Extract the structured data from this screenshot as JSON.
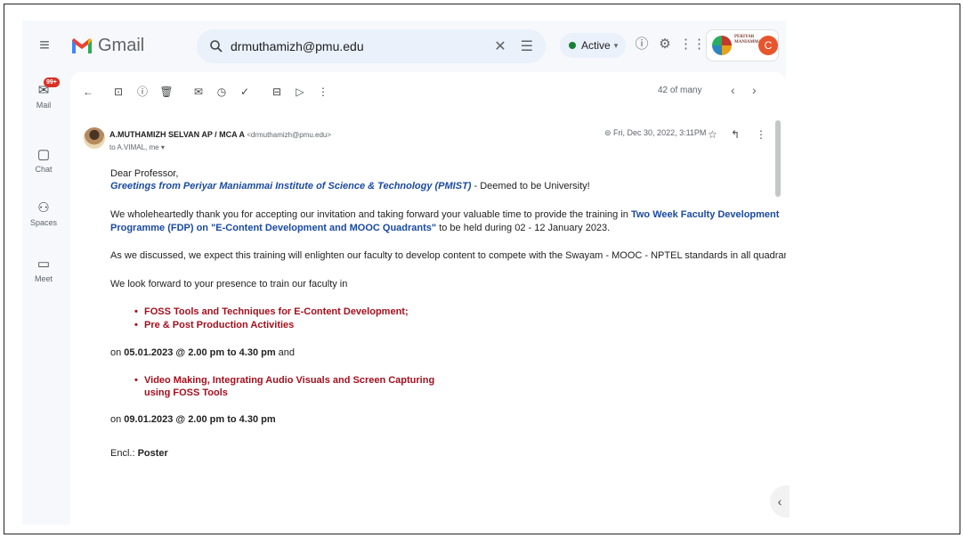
{
  "app": {
    "name": "Gmail",
    "brand_colors": [
      "#ea4335",
      "#4285f4",
      "#34a853",
      "#fbbc04"
    ]
  },
  "search": {
    "value": "drmuthamizh@pmu.edu"
  },
  "status": {
    "label": "Active",
    "color": "#188038"
  },
  "org": {
    "name": "PERIYAR MANIAMMAI"
  },
  "account": {
    "initial": "C",
    "color": "#e8552d"
  },
  "rail": {
    "mail_badge": "99+",
    "items": [
      {
        "label": "Mail",
        "icon": "mail-icon"
      },
      {
        "label": "Chat",
        "icon": "chat-icon"
      },
      {
        "label": "Spaces",
        "icon": "spaces-icon"
      },
      {
        "label": "Meet",
        "icon": "meet-icon"
      }
    ]
  },
  "toolbar": {
    "count": "42 of many"
  },
  "email": {
    "sender": "A.MUTHAMIZH SELVAN AP / MCA A",
    "sender_address": "<drmuthamizh@pmu.edu>",
    "to": "to A.VIMAL, me",
    "date": "Fri, Dec 30, 2022, 3:11PM",
    "greeting": "Dear Professor,",
    "greetings_line": "Greetings from Periyar Maniammai Institute of Science & Technology (PMIST)",
    "greetings_suffix": " - Deemed to be University!",
    "thanks_1": "We wholeheartedly thank you for accepting our invitation and taking forward your valuable time to provide the training in ",
    "thanks_link_1": "Two Week Faculty Development",
    "thanks_link_2": "Programme (FDP) on \"E-Content Development and MOOC Quadrants\"",
    "thanks_2": " to be held during 02 - 12 January 2023.",
    "discussed": "As we discussed, we expect this training will enlighten our faculty to develop content to compete with the Swayam - MOOC - NPTEL standards in all quadrants.",
    "forward": "We look forward to your presence to train our faculty in",
    "topics_1": [
      "FOSS Tools and Techniques for E-Content Development;",
      "Pre & Post Production Activities"
    ],
    "on_1_prefix": "on ",
    "on_1_bold": "05.01.2023 @ 2.00 pm to 4.30 pm",
    "on_1_suffix": " and",
    "topics_2": [
      "Video Making, Integrating Audio Visuals and Screen Capturing",
      "using FOSS Tools"
    ],
    "on_2_prefix": "on ",
    "on_2_bold": "09.01.2023 @ 2.00 pm to 4.30 pm",
    "encl_prefix": "Encl.: ",
    "encl_bold": "Poster"
  }
}
